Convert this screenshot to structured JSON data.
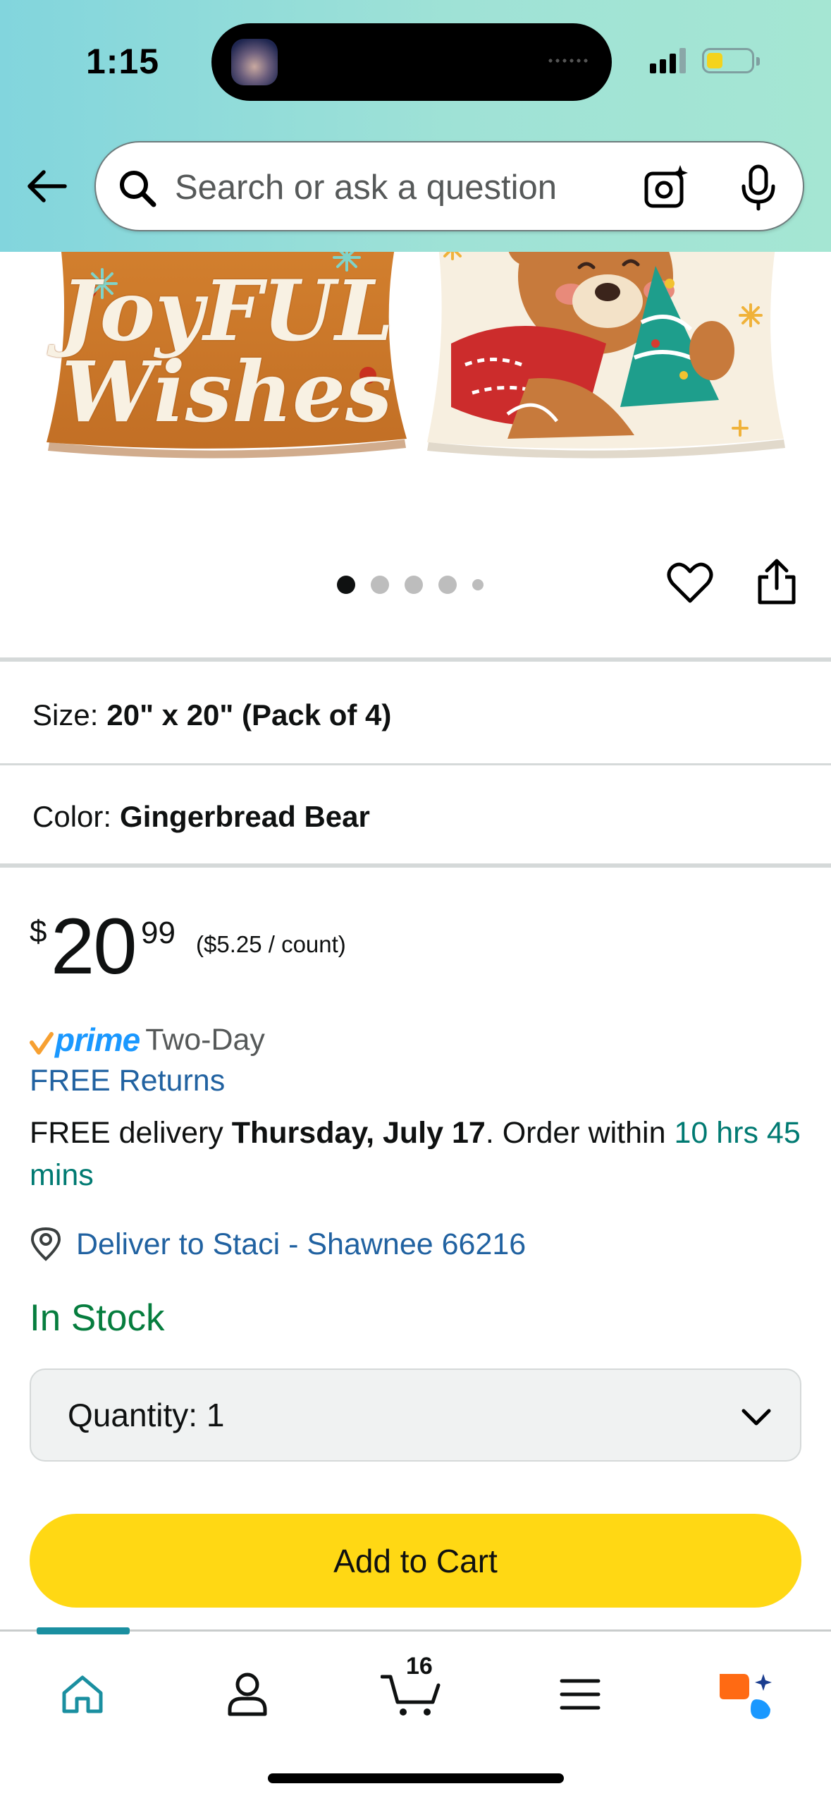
{
  "status_bar": {
    "time": "1:15"
  },
  "search": {
    "placeholder": "Search or ask a question"
  },
  "gallery": {
    "left_pillow_line1": "JoyFUL",
    "left_pillow_line2": "Wishes",
    "dots_count": 5,
    "active_dot": 1
  },
  "variants": {
    "size_label": "Size:",
    "size_value": "20\" x 20\" (Pack of 4)",
    "color_label": "Color:",
    "color_value": "Gingerbread Bear"
  },
  "price": {
    "symbol": "$",
    "whole": "20",
    "fraction": "99",
    "unit_price": "($5.25 / count)"
  },
  "shipping": {
    "prime_label": "prime",
    "prime_speed": "Two-Day",
    "free_returns": "FREE Returns",
    "delivery_prefix": "FREE delivery ",
    "delivery_date": "Thursday, July 17",
    "order_within_prefix": ". Order within ",
    "order_within_time": "10 hrs 45 mins",
    "deliver_to": "Deliver to Staci - Shawnee 66216"
  },
  "stock": {
    "status": "In Stock"
  },
  "quantity": {
    "label": "Quantity:",
    "value": "1"
  },
  "cart": {
    "add_button": "Add to Cart",
    "count": "16"
  },
  "colors": {
    "header_gradient_start": "#82d5dd",
    "header_gradient_end": "#a5e6d3",
    "add_to_cart": "#ffd814",
    "link": "#2162a1",
    "in_stock": "#067d3e",
    "teal_text": "#007a72",
    "prime_blue": "#1a98ff"
  },
  "icons": {
    "back": "arrow-left-icon",
    "search": "search-icon",
    "camera": "camera-icon",
    "mic": "microphone-icon",
    "wishlist": "heart-icon",
    "share": "share-icon",
    "location": "location-pin-icon",
    "chevron": "chevron-down-icon",
    "nav_home": "home-icon",
    "nav_account": "person-icon",
    "nav_cart": "cart-icon",
    "nav_menu": "menu-icon",
    "nav_rufus": "ai-assistant-icon"
  }
}
